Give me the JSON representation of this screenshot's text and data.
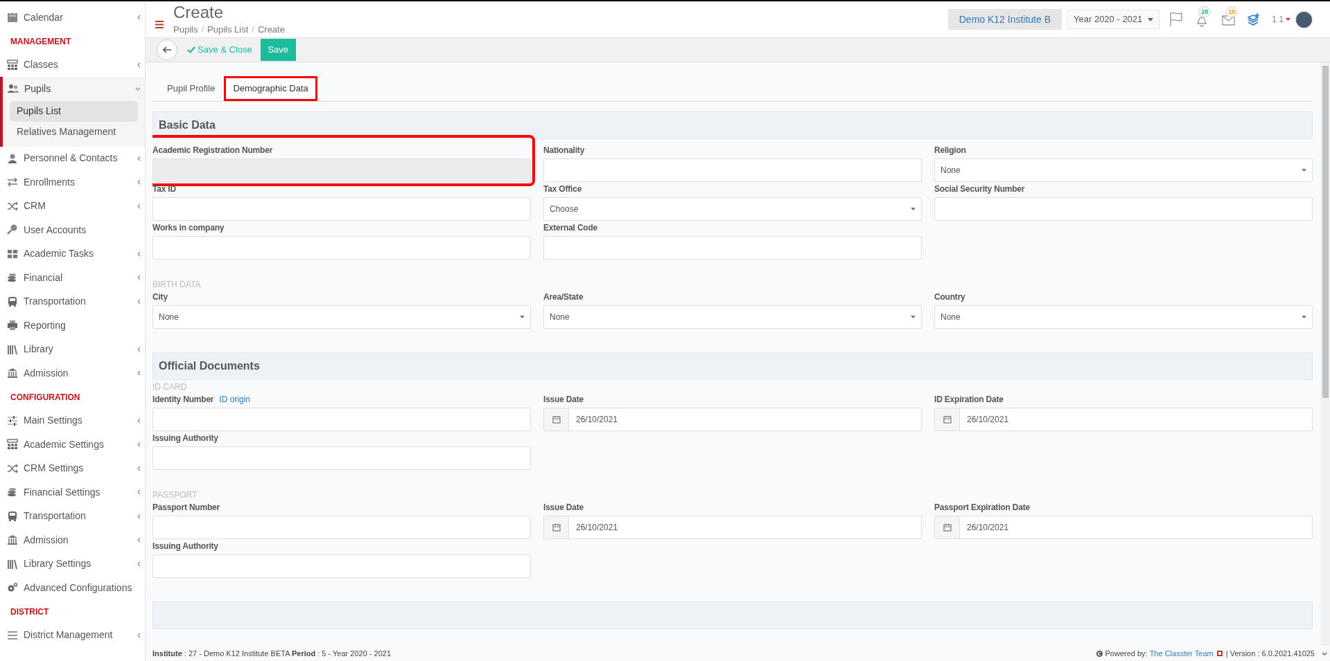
{
  "sidebar": [
    {
      "kind": "item",
      "label": "Calendar",
      "submenu": true
    },
    {
      "kind": "heading",
      "label": "MANAGEMENT"
    },
    {
      "kind": "item",
      "label": "Classes",
      "submenu": true
    },
    {
      "kind": "item",
      "label": "Pupils",
      "submenu": true,
      "expanded": true,
      "children": [
        {
          "label": "Pupils List",
          "selected": true
        },
        {
          "label": "Relatives Management",
          "selected": false
        }
      ]
    },
    {
      "kind": "item",
      "label": "Personnel & Contacts",
      "submenu": true
    },
    {
      "kind": "item",
      "label": "Enrollments",
      "submenu": true
    },
    {
      "kind": "item",
      "label": "CRM",
      "submenu": true
    },
    {
      "kind": "item",
      "label": "User Accounts",
      "submenu": false
    },
    {
      "kind": "item",
      "label": "Academic Tasks",
      "submenu": true
    },
    {
      "kind": "item",
      "label": "Financial",
      "submenu": true
    },
    {
      "kind": "item",
      "label": "Transportation",
      "submenu": true
    },
    {
      "kind": "item",
      "label": "Reporting",
      "submenu": false
    },
    {
      "kind": "item",
      "label": "Library",
      "submenu": true
    },
    {
      "kind": "item",
      "label": "Admission",
      "submenu": true
    },
    {
      "kind": "heading",
      "label": "CONFIGURATION"
    },
    {
      "kind": "item",
      "label": "Main Settings",
      "submenu": true
    },
    {
      "kind": "item",
      "label": "Academic Settings",
      "submenu": true
    },
    {
      "kind": "item",
      "label": "CRM Settings",
      "submenu": true
    },
    {
      "kind": "item",
      "label": "Financial Settings",
      "submenu": true
    },
    {
      "kind": "item",
      "label": "Transportation",
      "submenu": true
    },
    {
      "kind": "item",
      "label": "Admission",
      "submenu": true
    },
    {
      "kind": "item",
      "label": "Library Settings",
      "submenu": true
    },
    {
      "kind": "item",
      "label": "Advanced Configurations",
      "submenu": false
    },
    {
      "kind": "heading",
      "label": "DISTRICT"
    },
    {
      "kind": "item",
      "label": "District Management",
      "submenu": true
    }
  ],
  "header": {
    "title": "Create",
    "breadcrumb": [
      {
        "label": "Pupils",
        "separator": "/"
      },
      {
        "label": "Pupils List",
        "separator": "/"
      },
      {
        "label": "Create"
      }
    ],
    "institute": "Demo K12 Institute B",
    "year": "Year 2020 - 2021",
    "notifications": "28",
    "messages": "10",
    "user": "1 1"
  },
  "toolbar": {
    "save_close": "Save & Close",
    "save": "Save"
  },
  "tabs": [
    {
      "label": "Pupil Profile",
      "selected": false,
      "highlighted": false
    },
    {
      "label": "Demographic Data",
      "selected": true,
      "highlighted": true
    }
  ],
  "sections": [
    {
      "title": "Basic Data",
      "groups": [
        {
          "rows": [
            [
              {
                "kind": "readonly",
                "label": "Academic Registration Number",
                "highlighted": true
              },
              {
                "kind": "text",
                "label": "Nationality"
              },
              {
                "kind": "select",
                "label": "Religion",
                "value": "None"
              }
            ],
            [
              {
                "kind": "text",
                "label": "Tax ID"
              },
              {
                "kind": "select",
                "label": "Tax Office",
                "value": "Choose"
              },
              {
                "kind": "text",
                "label": "Social Security Number"
              }
            ],
            [
              {
                "kind": "text",
                "label": "Works in company"
              },
              {
                "kind": "text",
                "label": "External Code"
              }
            ]
          ]
        },
        {
          "caption": "BIRTH DATA",
          "rows": [
            [
              {
                "kind": "select",
                "label": "City",
                "value": "None"
              },
              {
                "kind": "select",
                "label": "Area/State",
                "value": "None"
              },
              {
                "kind": "select",
                "label": "Country",
                "value": "None"
              }
            ]
          ]
        }
      ]
    },
    {
      "title": "Official Documents",
      "groups": [
        {
          "caption": "ID CARD",
          "rows": [
            [
              {
                "kind": "text",
                "label": "Identity Number",
                "link": "ID origin"
              },
              {
                "kind": "date",
                "label": "Issue Date",
                "value": "26/10/2021"
              },
              {
                "kind": "date",
                "label": "ID Expiration Date",
                "value": "26/10/2021"
              }
            ],
            [
              {
                "kind": "text",
                "label": "Issuing Authority"
              }
            ]
          ]
        },
        {
          "caption": "PASSPORT",
          "rows": [
            [
              {
                "kind": "text",
                "label": "Passport Number"
              },
              {
                "kind": "date",
                "label": "Issue Date",
                "value": "26/10/2021"
              },
              {
                "kind": "date",
                "label": "Passport Expiration Date",
                "value": "26/10/2021"
              }
            ],
            [
              {
                "kind": "text",
                "label": "Issuing Authority"
              }
            ]
          ]
        }
      ]
    }
  ],
  "footer": {
    "info": "**Institute** : 27 - Demo K12 Institute BETA **Period** : 5 - Year 2020 - 2021",
    "powered": "Powered by:",
    "team": "The Classter Team",
    "version": "| Version : 6.0.2021.41025"
  }
}
